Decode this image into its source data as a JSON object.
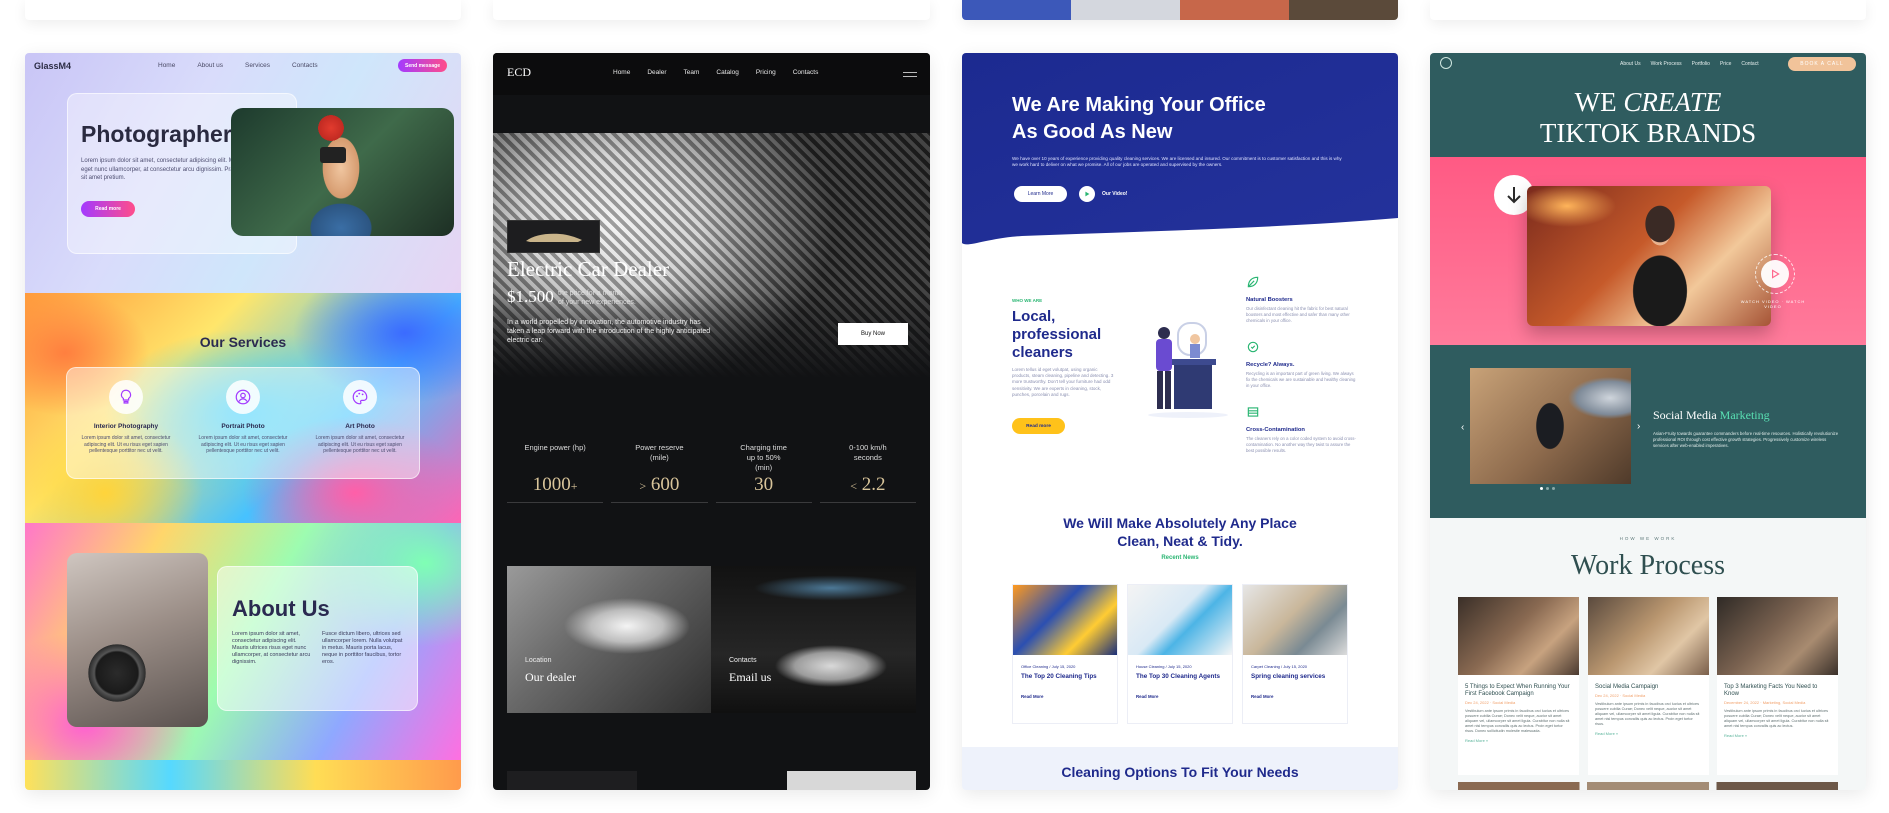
{
  "card1": {
    "brand": "GlassM4",
    "nav": [
      "Home",
      "About us",
      "Services",
      "Contacts"
    ],
    "cta": "Send message",
    "hero_title": "Photographer",
    "hero_text": "Lorem ipsum dolor sit amet, consectetur adipiscing elit. Mauris ultrices risus eget nunc ullamcorper, at consectetur arcu dignissim. Praesent lobortis in est sit amet pretium.",
    "hero_button": "Read more",
    "services_title": "Our Services",
    "services": [
      {
        "label": "Interior Photography",
        "text": "Lorem ipsum dolor sit amet, consectetur adipiscing elit. Ut eu risus eget sapien pellentesque porttitor nec ut velit.",
        "icon": "bulb-icon"
      },
      {
        "label": "Portrait Photo",
        "text": "Lorem ipsum dolor sit amet, consectetur adipiscing elit. Ut eu risus eget sapien pellentesque porttitor nec ut velit.",
        "icon": "user-icon"
      },
      {
        "label": "Art Photo",
        "text": "Lorem ipsum dolor sit amet, consectetur adipiscing elit. Ut eu risus eget sapien pellentesque porttitor nec ut velit.",
        "icon": "palette-icon"
      }
    ],
    "about_title": "About Us",
    "about_text_left": "Lorem ipsum dolor sit amet, consectetur adipiscing elit. Mauris ultrices risus eget nunc ullamcorper, at consectetur arcu dignissim.",
    "about_text_right": "Fusce dictum libero, ultrices sed ullamcorper lorem. Nulla volutpat in metus. Mauris porta lacus, neque in porttitor faucibus, tortor eros."
  },
  "card2": {
    "brand": "ECD",
    "nav": [
      "Home",
      "Dealer",
      "Team",
      "Catalog",
      "Pricing",
      "Contacts"
    ],
    "hero_title": "Electric Car Dealer",
    "price": "$1.500",
    "price_note_1": "the price for a month",
    "price_note_2": "of your new experiences.",
    "hero_text": "In a world propelled by innovation, the automotive industry has taken a leap forward with the introduction of the highly anticipated electric car.",
    "hero_button": "Buy Now",
    "stats": [
      {
        "label": "Engine power (hp)",
        "value": "1000",
        "prefix": "",
        "suffix": "+"
      },
      {
        "label": "Power reserve (mile)",
        "value": "600",
        "prefix": ">",
        "suffix": ""
      },
      {
        "label": "Charging time up to 50% (min)",
        "value": "30",
        "prefix": "",
        "suffix": ""
      },
      {
        "label": "0-100 km/h seconds",
        "value": "2.2",
        "prefix": "<",
        "suffix": ""
      }
    ],
    "tiles": [
      {
        "kicker": "Location",
        "title": "Our dealer"
      },
      {
        "kicker": "Contacts",
        "title": "Email us"
      }
    ]
  },
  "card3": {
    "hero_title_1": "We Are Making Your Office",
    "hero_title_2": "As Good As New",
    "hero_text": "We have over 10 years of experience providing quality cleaning services. We are licensed and insured. Our commitment is to customer satisfaction and this is why we work hard to deliver on what we promise. All of our jobs are operated and supervised by the owners.",
    "learn_more": "Learn More",
    "our_video": "Our Video!",
    "who_we_are": "WHO WE ARE",
    "local_title": "Local, professional cleaners",
    "local_text": "Lorem tellus id eget volutpat, using organic products, steam cleaning, pipeline and detecting. 3 more trustworthy. Don't tell your furniture had odd sensitivity. We are experts in cleaning, stock, punches, porcelain and rugs.",
    "read_more": "Read more",
    "features": [
      {
        "title": "Natural Boosters",
        "text": "Our disinfectant cleaning hit the fabric for best natural boosters and most effective and safer than many other chemicals in your office.",
        "icon": "leaf-icon"
      },
      {
        "title": "Recycle? Always.",
        "text": "Recycling is an important part of green living. We always fix the chemicals we are sustainable and healthy cleaning in your office.",
        "icon": "recycle-icon"
      },
      {
        "title": "Cross-Contamination",
        "text": "The cleaners rely on a color coded system to avoid cross-contamination. No another way they twist to assure the best possible results.",
        "icon": "grid-icon"
      }
    ],
    "mission_1": "We Will Make Absolutely Any Place",
    "mission_2": "Clean, Neat & Tidy.",
    "recent_news": "Recent News",
    "news": [
      {
        "meta": "Office Cleaning / July 15, 2020",
        "title": "The Top 20 Cleaning Tips",
        "link": "Read More"
      },
      {
        "meta": "House Cleaning / July 15, 2020",
        "title": "The Top 30 Cleaning Agents",
        "link": "Read More"
      },
      {
        "meta": "Carpet Cleaning / July 15, 2020",
        "title": "Spring cleaning services",
        "link": "Read More"
      }
    ],
    "options_title": "Cleaning Options To Fit Your Needs"
  },
  "card4": {
    "nav": [
      "About Us",
      "Work Process",
      "Portfolio",
      "Price",
      "Contact"
    ],
    "cta": "BOOK A CALL",
    "hero_line_1_a": "WE",
    "hero_line_1_b": "CREATE",
    "hero_line_2": "TIKTOK BRANDS",
    "play_ring": "WATCH VIDEO · WATCH VIDEO",
    "social_a": "Social Media",
    "social_b": "Marketing",
    "social_text": "Asian-Fruity towards guarantee commanders before real-time resources. Holistically revolutionize professional ROI through cost effective growth strategies. Progressively customize wireless services after web-enabled imperatives.",
    "how_we_work": "HOW WE WORK",
    "process_title": "Work Process",
    "process": [
      {
        "title": "5 Things to Expect When Running Your First Facebook Campaign",
        "meta": "Dec 24, 2022 · Social Media",
        "text": "Vestibulum ante ipsum primis in faucibus orci luctus et ultrices posuere cubilia Curae; Donec velit neque, auctor sit amet aliquam vel, ullamcorper sit amet ligula. Curabitur non nulla sit amet nisl tempus convallis quis ac lectus. Proin eget tortor risus. Donec sollicitudin molestie malesuada.",
        "link": "Read More »"
      },
      {
        "title": "Social Media Campaign",
        "meta": "Dec 24, 2022 · Social Media",
        "text": "Vestibulum ante ipsum primis in faucibus orci luctus et ultrices posuere cubilia Curae; Donec velit neque, auctor sit amet aliquam vel, ullamcorper sit amet ligula. Curabitur non nulla sit amet nisl tempus convallis quis ac lectus. Proin eget tortor risus.",
        "link": "Read More »"
      },
      {
        "title": "Top 3 Marketing Facts You Need to Know",
        "meta": "December 24, 2022 · Marketing, Social Media",
        "text": "Vestibulum ante ipsum primis in faucibus orci luctus et ultrices posuere cubilia Curae; Donec velit neque, auctor sit amet aliquam vel, ullamcorper sit amet ligula. Curabitur non nulla sit amet nisl tempus convallis quis ac lectus.",
        "link": "Read More »"
      }
    ]
  },
  "colors": {
    "glass_accent": "#a33bff",
    "dark_bg": "#111214",
    "gold": "#d8c49a",
    "navy": "#1f2a8c",
    "clean_yellow": "#ffc21a",
    "clean_green": "#2bb673",
    "teal": "#2f5c5f",
    "mint": "#59e0b3",
    "peach": "#f1c39a"
  }
}
